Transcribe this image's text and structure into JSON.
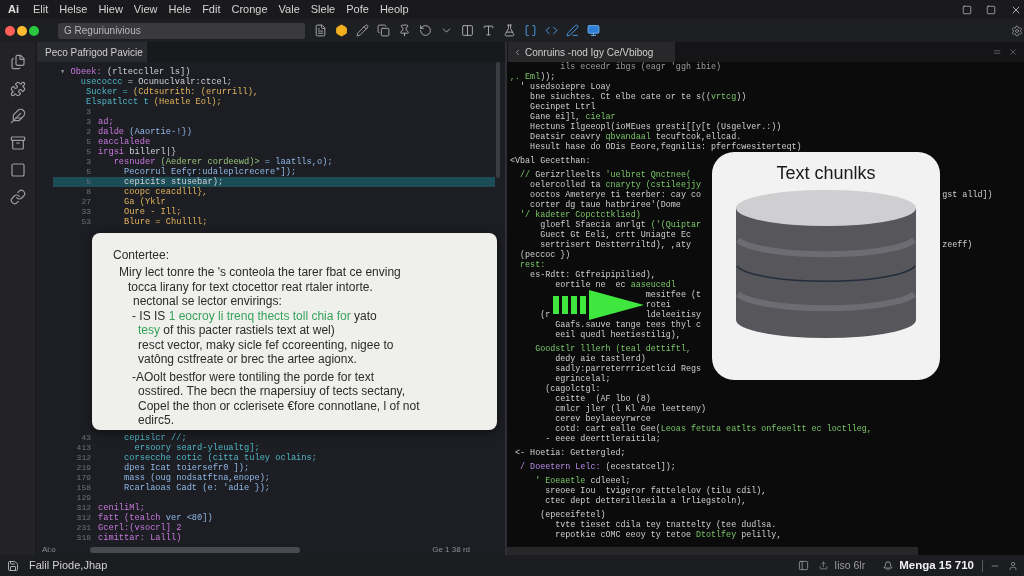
{
  "menu_bar": {
    "app_mark": "Ai",
    "items": [
      "Elit",
      "Helse",
      "Hiew",
      "View",
      "Hele",
      "Fdit",
      "Cronge",
      "Vale",
      "Slele",
      "Pofe",
      "Heolp"
    ]
  },
  "toolbar": {
    "search": {
      "value": "G Reguriunivious"
    }
  },
  "left_editor": {
    "tab": "Peco Pafrigod Pavicie",
    "lines_top": [
      {
        "selected": false,
        "parts": [
          {
            "kind": "dim",
            "text": "▾ "
          },
          {
            "kind": "keyword",
            "text": "Obeek:"
          },
          {
            "kind": "plain",
            "text": " (rlteccller ls])"
          }
        ]
      },
      {
        "selected": false,
        "parts": [
          {
            "kind": "teal",
            "text": "    usecoccc"
          },
          {
            "kind": "plain",
            "text": " = Ocunuclvalr:ctcel;"
          }
        ]
      },
      {
        "selected": false,
        "parts": [
          {
            "kind": "teal",
            "text": "     Sucker ="
          },
          {
            "kind": "string",
            "text": " (Cdtsurrith: (erurrill),"
          }
        ]
      },
      {
        "selected": false,
        "parts": [
          {
            "kind": "teal",
            "text": "     Elspatlcct t"
          },
          {
            "kind": "string",
            "text": " (Heatle Eol);"
          }
        ]
      },
      {
        "num": "3",
        "selected": false
      },
      {
        "num": "3",
        "selected": false,
        "parts": [
          {
            "kind": "keyword",
            "text": "ad;"
          }
        ]
      },
      {
        "num": "2",
        "selected": false,
        "parts": [
          {
            "kind": "keyword",
            "text": "dalde"
          },
          {
            "kind": "blue",
            "text": " (Aaortie-!})"
          }
        ]
      },
      {
        "num": "5",
        "selected": false,
        "parts": [
          {
            "kind": "keyword",
            "text": "eacclalede"
          }
        ]
      },
      {
        "num": "5",
        "selected": false,
        "parts": [
          {
            "kind": "keyword",
            "text": "irgsi"
          },
          {
            "kind": "plain",
            "text": " billerl|}"
          }
        ]
      },
      {
        "num": "3",
        "selected": false,
        "parts": [
          {
            "kind": "keyword",
            "text": "   resnuder"
          },
          {
            "kind": "green",
            "text": " (Aederer cordeewd)>"
          },
          {
            "kind": "blue",
            "text": " = laatlls,o);"
          }
        ]
      },
      {
        "num": "5",
        "selected": false,
        "parts": [
          {
            "kind": "blue",
            "text": "     Pecorrul Eefçr:udaleplcrecere*]);"
          }
        ]
      },
      {
        "num": "5",
        "selected": true,
        "parts": [
          {
            "kind": "plain",
            "text": "     cepicits stusebar);"
          }
        ]
      },
      {
        "num": "8",
        "selected": false,
        "parts": [
          {
            "kind": "string",
            "text": "     coopc ceacdlll},"
          }
        ]
      },
      {
        "num": "27",
        "selected": false,
        "parts": [
          {
            "kind": "string",
            "text": "     Ga (Yklr"
          }
        ]
      },
      {
        "num": "33",
        "selected": false,
        "parts": [
          {
            "kind": "string",
            "text": "     Oure - Ill;"
          }
        ]
      },
      {
        "num": "53",
        "selected": false,
        "parts": [
          {
            "kind": "string",
            "text": "     Blure = Chullll;"
          }
        ]
      }
    ],
    "lines_bottom": [
      {
        "num": "43",
        "selected": false,
        "parts": [
          {
            "kind": "teal",
            "text": "     cepislcr //;"
          }
        ]
      },
      {
        "num": "413",
        "selected": false,
        "parts": [
          {
            "kind": "teal",
            "text": "       ersoory seard-yleualtg];"
          }
        ]
      },
      {
        "num": "312",
        "selected": false,
        "parts": [
          {
            "kind": "teal",
            "text": "     corsecche cotic (citta tuley oclains;"
          }
        ]
      },
      {
        "num": "219",
        "selected": false,
        "parts": [
          {
            "kind": "blue",
            "text": "     dpes Icat toiersefr0 ]);"
          }
        ]
      },
      {
        "num": "179",
        "selected": false,
        "parts": [
          {
            "kind": "blue",
            "text": "     mass (oug nodsatftna,enope);"
          }
        ]
      },
      {
        "num": "158",
        "selected": false,
        "parts": [
          {
            "kind": "blue",
            "text": "     Rcarlaoas Cadt (e: 'adie });"
          }
        ]
      },
      {
        "num": "129",
        "selected": false
      },
      {
        "num": "312",
        "selected": false,
        "parts": [
          {
            "kind": "keyword",
            "text": "ceniliMl;"
          }
        ]
      },
      {
        "num": "312",
        "selected": false,
        "parts": [
          {
            "kind": "keyword",
            "text": "fatt (tealch "
          },
          {
            "kind": "blue",
            "text": "ver <80])"
          }
        ]
      },
      {
        "num": "231",
        "selected": false,
        "parts": [
          {
            "kind": "keyword",
            "text": "Gcerl:(vsocrl] 2"
          }
        ]
      },
      {
        "num": "318",
        "selected": false,
        "parts": [
          {
            "kind": "keyword",
            "text": "cimittar: Lalll)"
          }
        ]
      }
    ],
    "popup": {
      "heading": "Contertee:",
      "paragraphs": [
        {
          "kind": "text",
          "lines": [
            {
              "parts": [
                {
                  "kind": "plain",
                  "text": "Miry lect tonre the 's conteola the tarer fbat ce enving"
                }
              ]
            },
            {
              "parts": [
                {
                  "kind": "plain",
                  "text": "tocca lirany for text ctocettor reat rtaler intorte."
                }
              ]
            }
          ]
        },
        {
          "kind": "label",
          "lines": [
            {
              "parts": [
                {
                  "kind": "plain",
                  "text": "nectonal se lector envirings:"
                }
              ]
            }
          ]
        },
        {
          "kind": "bullet",
          "lines": [
            {
              "parts": [
                {
                  "kind": "plain",
                  "text": "- IS IS "
                },
                {
                  "kind": "accent",
                  "text": "1 eocroy li trenq thects toll chia for"
                },
                {
                  "kind": "plain",
                  "text": " yato"
                }
              ]
            },
            {
              "parts": [
                {
                  "kind": "accent",
                  "text": "tesy"
                },
                {
                  "kind": "plain",
                  "text": " of this pacter rastiels text at wel)"
                }
              ]
            },
            {
              "parts": [
                {
                  "kind": "plain",
                  "text": "resct vector, maky sicle fef ccoreenting, nigee to"
                }
              ]
            },
            {
              "parts": [
                {
                  "kind": "plain",
                  "text": "vatông cstfreate or brec the artee agionx."
                }
              ]
            }
          ]
        },
        {
          "kind": "bullet",
          "lines": [
            {
              "parts": [
                {
                  "kind": "plain",
                  "text": "-AOolt bestfor were tontiling the porde for text"
                }
              ]
            },
            {
              "parts": [
                {
                  "kind": "plain",
                  "text": "osstired. The becn the rnapersiuy of tects sectany,"
                }
              ]
            },
            {
              "parts": [
                {
                  "kind": "plain",
                  "text": "Copel the thon or cclerisete €fore connotlane, l of not"
                }
              ]
            },
            {
              "parts": [
                {
                  "kind": "plain",
                  "text": "edirc5."
                }
              ]
            }
          ]
        }
      ]
    },
    "footer": {
      "left": "Ai:o",
      "right": "Ge 1 38 rd"
    }
  },
  "right_editor": {
    "tab": "Conruins -nod Igy Ce/Vbibog",
    "blocks": [
      {
        "lines": [
          {
            "parts": [
              {
                "kind": "dim",
                "text": "          ils eceedr ibgs (eagr 'ggh ibie)"
              }
            ]
          },
          {
            "parts": [
              {
                "kind": "green",
                "text": ",. Eml"
              },
              {
                "kind": "plain",
                "text": "));"
              }
            ]
          },
          {
            "parts": [
              {
                "kind": "plain",
                "text": "  ' usedsoiepre Loay"
              }
            ]
          },
          {
            "parts": [
              {
                "kind": "plain",
                "text": "    bne siuchtes. Ct elbe cate or te s(("
              },
              {
                "kind": "green",
                "text": "vrtcg"
              },
              {
                "kind": "plain",
                "text": "))"
              }
            ]
          },
          {
            "parts": [
              {
                "kind": "plain",
                "text": "    Gecinpet Ltrl"
              }
            ]
          },
          {
            "parts": [
              {
                "kind": "plain",
                "text": "    Gane ei]l, "
              },
              {
                "kind": "green",
                "text": "cielar"
              }
            ]
          },
          {
            "parts": [
              {
                "kind": "plain",
                "text": "    Hectuns Ilgeeopl(ioMEues gresti[[y[t (Usgelver.:))"
              }
            ]
          },
          {
            "parts": [
              {
                "kind": "plain",
                "text": "    Deatsir ceavry "
              },
              {
                "kind": "green",
                "text": "qbvandaal"
              },
              {
                "kind": "plain",
                "text": " tecuftcok,ellcad."
              }
            ]
          },
          {
            "parts": [
              {
                "kind": "plain",
                "text": "    Hesult hase do ODis Eeore,fegnilis: pferfcwesiterteqt)"
              }
            ]
          }
        ]
      },
      {
        "lines": [
          {
            "parts": [
              {
                "kind": "plain",
                "text": "<Vbal Gecetthan:"
              }
            ]
          }
        ]
      },
      {
        "lines": [
          {
            "parts": [
              {
                "kind": "green",
                "text": "  // "
              },
              {
                "kind": "plain",
                "text": "Gerizrlleelts "
              },
              {
                "kind": "green",
                "text": "'uelbret Qnctnee("
              }
            ]
          },
          {
            "parts": [
              {
                "kind": "plain",
                "text": "    oelercolled ta "
              },
              {
                "kind": "green",
                "text": "cnaryty (cstileejjy"
              }
            ]
          },
          {
            "parts": [
              {
                "kind": "plain",
                "text": "    ooctos Ameterye ti teerber: cay co"
              }
            ],
            "after": [
              {
                "kind": "plain",
                "text": "                                                gst alld])"
              }
            ]
          },
          {
            "parts": [
              {
                "kind": "plain",
                "text": "    corter dg taue hatbriree'(Dome"
              }
            ]
          },
          {
            "parts": [
              {
                "kind": "green",
                "text": "  '/ kadeter Copctctklied)"
              }
            ]
          },
          {
            "parts": [
              {
                "kind": "plain",
                "text": "      gloefl Sfaecia anrlgt "
              },
              {
                "kind": "green",
                "text": "('(Quiptar"
              }
            ]
          },
          {
            "parts": [
              {
                "kind": "plain",
                "text": "      Guect Gt Eeli, crtt Uniagte Ec"
              }
            ]
          },
          {
            "parts": [
              {
                "kind": "plain",
                "text": "      sertrisert Destterriltd), ,aty"
              }
            ],
            "after": [
              {
                "kind": "plain",
                "text": "                                                  zeeff)"
              }
            ]
          },
          {
            "parts": [
              {
                "kind": "plain",
                "text": "  (peccoc })"
              }
            ]
          },
          {
            "parts": [
              {
                "kind": "green",
                "text": "  rest:"
              }
            ]
          },
          {
            "parts": [
              {
                "kind": "plain",
                "text": "    es-Rdtt: Gtfreipipilied),"
              }
            ]
          },
          {
            "parts": [
              {
                "kind": "plain",
                "text": "         eortile ne  ec "
              },
              {
                "kind": "green",
                "text": "aaseucedl"
              }
            ]
          },
          {
            "parts": [
              {
                "kind": "plain",
                "text": "                           mesitfee (t"
              }
            ]
          },
          {
            "parts": [
              {
                "kind": "plain",
                "text": "                           rotei"
              }
            ]
          },
          {
            "parts": [
              {
                "kind": "plain",
                "text": "      (r"
              }
            ],
            "after": [
              {
                "kind": "plain",
                "text": "                   ldeleeitisy"
              }
            ]
          },
          {
            "parts": [
              {
                "kind": "plain",
                "text": "         Gaafs.sauve tange tees thyl c"
              }
            ]
          },
          {
            "parts": [
              {
                "kind": "plain",
                "text": "         eeil quedl heetiestilig),"
              }
            ]
          }
        ]
      },
      {
        "lines": [
          {
            "parts": [
              {
                "kind": "green",
                "text": "     Goodstlr lllerh (teal dettiftl,"
              }
            ]
          },
          {
            "parts": [
              {
                "kind": "plain",
                "text": "         dedy aie tastlerd)"
              }
            ]
          },
          {
            "parts": [
              {
                "kind": "plain",
                "text": "         sadly:parreterrricetlcid Regs"
              }
            ]
          },
          {
            "parts": [
              {
                "kind": "plain",
                "text": "         egrincelal;"
              }
            ]
          },
          {
            "parts": [
              {
                "kind": "plain",
                "text": "       (cagolctgl:"
              }
            ]
          },
          {
            "parts": [
              {
                "kind": "plain",
                "text": "         ceitte  (AF lbo (8)"
              }
            ]
          },
          {
            "parts": [
              {
                "kind": "plain",
                "text": "         cmlcr jler (l Kl Ane leetteny)"
              }
            ]
          },
          {
            "parts": [
              {
                "kind": "plain",
                "text": "         cerev beylaeeyrwrce"
              }
            ]
          },
          {
            "parts": [
              {
                "kind": "plain",
                "text": "         cotd: cart ealle Gee("
              },
              {
                "kind": "green",
                "text": "Leoas fetuta eatlts onfeeeltt ec loctlleg,"
              }
            ]
          },
          {
            "parts": [
              {
                "kind": "plain",
                "text": "       - eeee deerttleraitila;"
              }
            ]
          }
        ]
      },
      {
        "lines": [
          {
            "parts": [
              {
                "kind": "plain",
                "text": " <- Hoetia: Gettergled;"
              }
            ]
          }
        ]
      },
      {
        "lines": [
          {
            "parts": [
              {
                "kind": "purple",
                "text": "  / Doeetern Lelc:"
              },
              {
                "kind": "plain",
                "text": " (ecestatcel]);"
              }
            ]
          }
        ]
      },
      {
        "lines": [
          {
            "parts": [
              {
                "kind": "green",
                "text": "     ' Eoeaetle"
              },
              {
                "kind": "plain",
                "text": " cdleeel;"
              }
            ]
          },
          {
            "parts": [
              {
                "kind": "plain",
                "text": "       sreoee Iou  tvigeror fattelelov (tilu cdil),"
              }
            ]
          },
          {
            "parts": [
              {
                "kind": "plain",
                "text": "       ctec dept detterilleeila a lrliegstoln),"
              }
            ]
          }
        ]
      },
      {
        "lines": [
          {
            "parts": [
              {
                "kind": "plain",
                "text": "      (epeceifetel)"
              }
            ]
          },
          {
            "parts": [
              {
                "kind": "plain",
                "text": "         tvte tieset cdila tey tnattelty (tee dudlsa."
              }
            ]
          },
          {
            "parts": [
              {
                "kind": "plain",
                "text": "         repotkie cOMC eeoy ty tetoe "
              },
              {
                "kind": "green",
                "text": "Dtotlfey"
              },
              {
                "kind": "plain",
                "text": " pelilly,"
              }
            ]
          }
        ]
      }
    ],
    "card": {
      "title": "Text chunlks"
    }
  },
  "status_bar": {
    "left": "Falil Piode,Jhap",
    "info": "Iiso 6lr",
    "position": "Menga 15 710"
  }
}
